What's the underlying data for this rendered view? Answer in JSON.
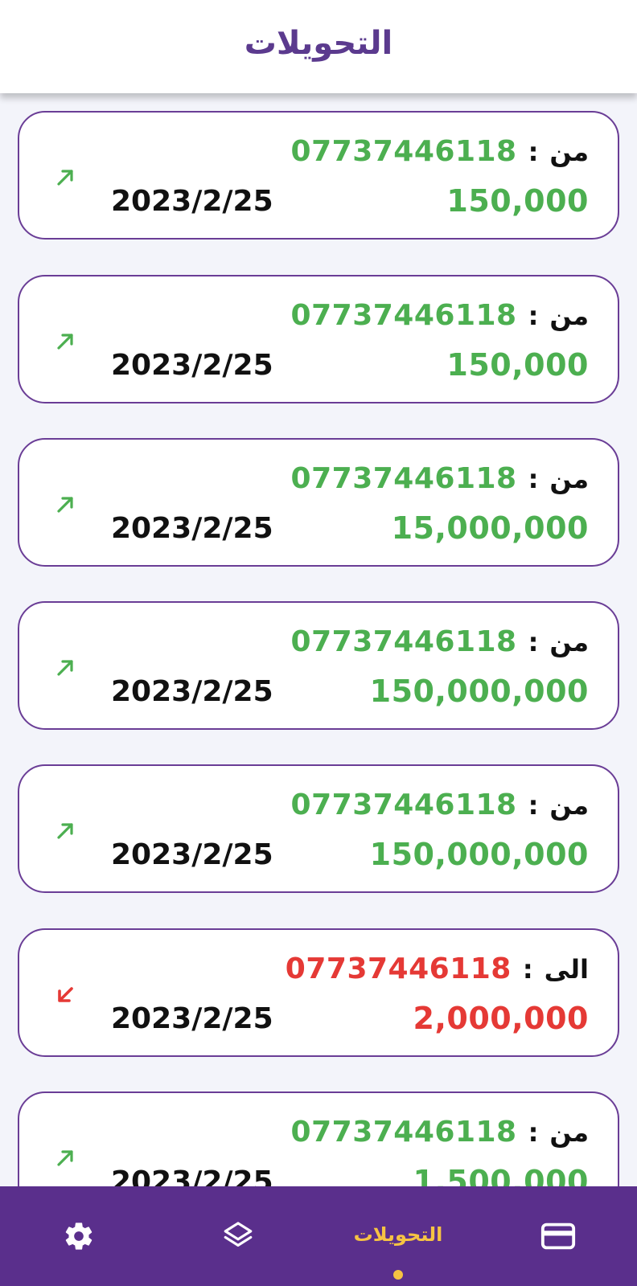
{
  "header": {
    "title": "التحويلات"
  },
  "colors": {
    "incoming": "#4caf50",
    "outgoing": "#e53935",
    "accent": "#5a2f8c",
    "active_nav": "#f6c343"
  },
  "transactions": [
    {
      "direction": "incoming",
      "label": "من",
      "colon": ":",
      "phone": "07737446118",
      "amount": "150,000",
      "date": "2023/2/25",
      "icon": "arrow-up-right-icon"
    },
    {
      "direction": "incoming",
      "label": "من",
      "colon": ":",
      "phone": "07737446118",
      "amount": "150,000",
      "date": "2023/2/25",
      "icon": "arrow-up-right-icon"
    },
    {
      "direction": "incoming",
      "label": "من",
      "colon": ":",
      "phone": "07737446118",
      "amount": "15,000,000",
      "date": "2023/2/25",
      "icon": "arrow-up-right-icon"
    },
    {
      "direction": "incoming",
      "label": "من",
      "colon": ":",
      "phone": "07737446118",
      "amount": "150,000,000",
      "date": "2023/2/25",
      "icon": "arrow-up-right-icon"
    },
    {
      "direction": "incoming",
      "label": "من",
      "colon": ":",
      "phone": "07737446118",
      "amount": "150,000,000",
      "date": "2023/2/25",
      "icon": "arrow-up-right-icon"
    },
    {
      "direction": "outgoing",
      "label": "الى",
      "colon": ":",
      "phone": "07737446118",
      "amount": "2,000,000",
      "date": "2023/2/25",
      "icon": "arrow-down-left-icon"
    },
    {
      "direction": "incoming",
      "label": "من",
      "colon": ":",
      "phone": "07737446118",
      "amount": "1,500,000",
      "date": "2023/2/25",
      "icon": "arrow-up-right-icon"
    }
  ],
  "bottom_nav": {
    "settings_icon": "gear-icon",
    "layers_icon": "layers-icon",
    "transfers_label": "التحويلات",
    "card_icon": "credit-card-icon",
    "active": "transfers"
  }
}
